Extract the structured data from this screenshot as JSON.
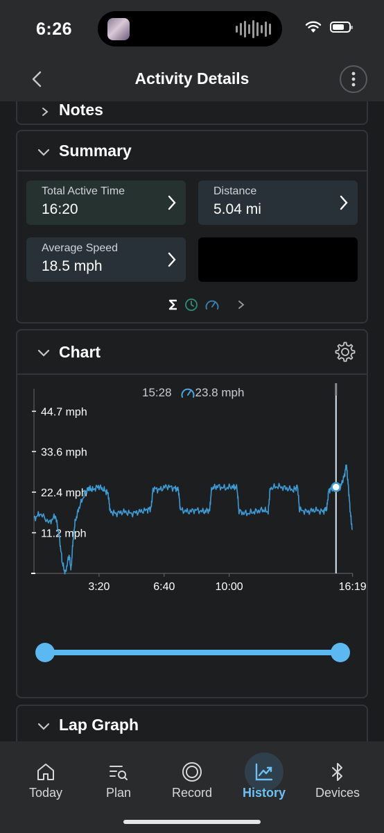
{
  "status_bar": {
    "time": "6:26"
  },
  "nav": {
    "title": "Activity Details"
  },
  "sections": {
    "notes": {
      "title": "Notes"
    },
    "summary": {
      "title": "Summary",
      "tiles": [
        {
          "label": "Total Active Time",
          "value": "16:20"
        },
        {
          "label": "Distance",
          "value": "5.04 mi"
        },
        {
          "label": "Average Speed",
          "value": "18.5 mph"
        }
      ],
      "pager_icons": [
        "sigma-icon",
        "clock-icon",
        "speedometer-icon"
      ]
    },
    "chart": {
      "title": "Chart",
      "cursor": {
        "time": "15:28",
        "value": "23.8 mph"
      },
      "range_slider": {
        "start": 0.0,
        "end": 1.0
      }
    },
    "lap_graph": {
      "title": "Lap Graph"
    }
  },
  "chart_data": {
    "type": "line",
    "xlabel": "",
    "ylabel": "",
    "x_tick_labels": [
      "3:20",
      "6:40",
      "10:00",
      "16:19"
    ],
    "x_ticks_minutes": [
      3.333,
      6.667,
      10.0,
      16.317
    ],
    "y_tick_labels": [
      "11.2 mph",
      "22.4 mph",
      "33.6 mph",
      "44.7 mph"
    ],
    "y_ticks": [
      11.2,
      22.4,
      33.6,
      44.7
    ],
    "xlim": [
      0,
      16.33
    ],
    "ylim": [
      0,
      49
    ],
    "grid": false,
    "series": [
      {
        "color": "#3d9bd6",
        "x": [
          0,
          0.3,
          0.8,
          1.1,
          1.3,
          1.45,
          1.6,
          1.8,
          1.9,
          2.0,
          2.1,
          2.3,
          2.6,
          2.8,
          3.0,
          3.3,
          3.6,
          3.8,
          3.9,
          4.2,
          4.6,
          5.0,
          5.4,
          5.8,
          6.0,
          6.1,
          6.4,
          6.8,
          7.2,
          7.4,
          7.5,
          7.9,
          8.3,
          8.7,
          9.0,
          9.1,
          9.4,
          9.8,
          10.2,
          10.4,
          10.5,
          10.9,
          11.3,
          11.7,
          12.0,
          12.1,
          12.5,
          12.9,
          13.3,
          13.5,
          13.6,
          14.0,
          14.4,
          14.8,
          15.0,
          15.1,
          15.3,
          15.5,
          15.7,
          15.9,
          16.0,
          16.1,
          16.2,
          16.3
        ],
        "y": [
          15,
          16.5,
          14,
          16,
          10,
          3,
          0,
          5,
          1,
          9,
          14,
          18,
          22,
          23.5,
          23,
          24,
          23,
          22,
          17,
          16.5,
          17,
          16.5,
          17,
          17.5,
          18,
          23.5,
          23,
          24,
          23.5,
          23,
          17.5,
          17,
          17.5,
          17,
          17.5,
          23.5,
          24,
          23.5,
          24,
          23.5,
          17,
          16.5,
          17,
          17.5,
          17,
          23.5,
          24,
          23.5,
          23,
          24,
          17.5,
          17,
          17.5,
          17,
          18,
          23,
          23.5,
          24,
          23.8,
          27,
          30,
          24,
          17,
          12
        ]
      }
    ]
  },
  "tab_bar": {
    "tabs": [
      {
        "label": "Today",
        "icon": "home-icon"
      },
      {
        "label": "Plan",
        "icon": "plan-search-icon"
      },
      {
        "label": "Record",
        "icon": "record-icon"
      },
      {
        "label": "History",
        "icon": "chart-trend-icon",
        "active": true
      },
      {
        "label": "Devices",
        "icon": "bluetooth-icon"
      }
    ]
  },
  "colors": {
    "accent": "#5cb8f0",
    "active_tab": "#6bc1f5",
    "line": "#3d9bd6",
    "background": "#1b1c1e"
  }
}
